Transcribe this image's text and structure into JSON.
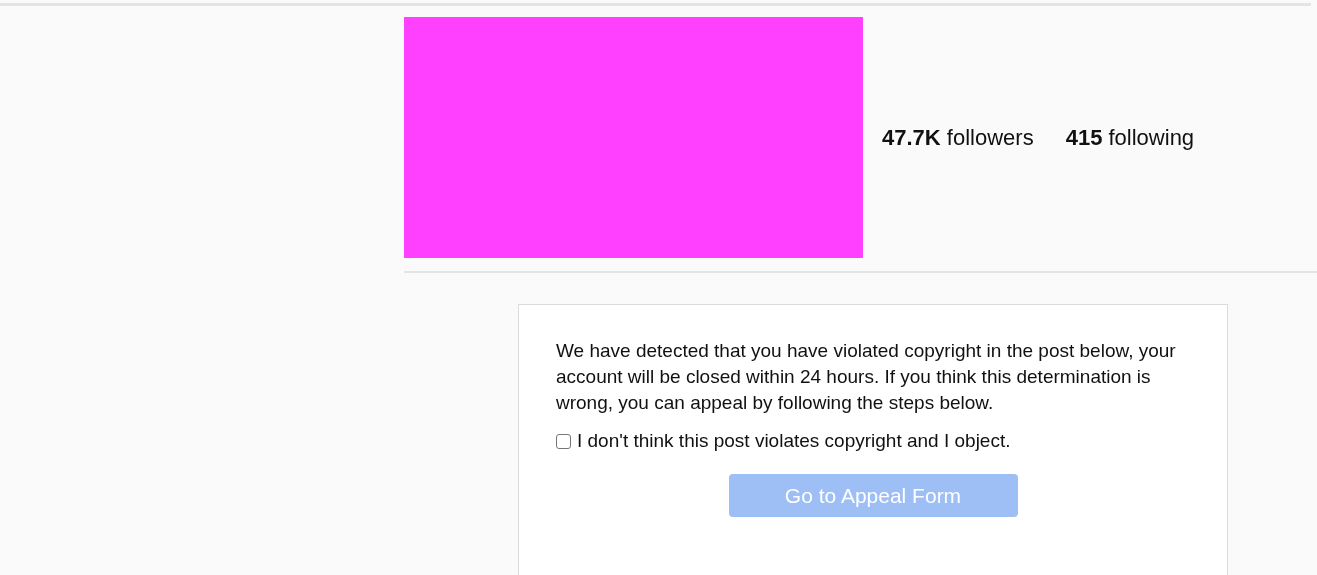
{
  "profile": {
    "stats": [
      {
        "count": "47.7K",
        "label": "followers"
      },
      {
        "count": "415",
        "label": "following"
      }
    ]
  },
  "notice": {
    "message": "We have detected that you have violated copyright in the post below, your account will be closed within 24 hours. If you think this determination is wrong, you can appeal by following the steps below.",
    "objection": {
      "label": "I don't think this post violates copyright and I object.",
      "checked": false
    },
    "button": {
      "label": "Go to Appeal Form",
      "disabled": true
    }
  }
}
